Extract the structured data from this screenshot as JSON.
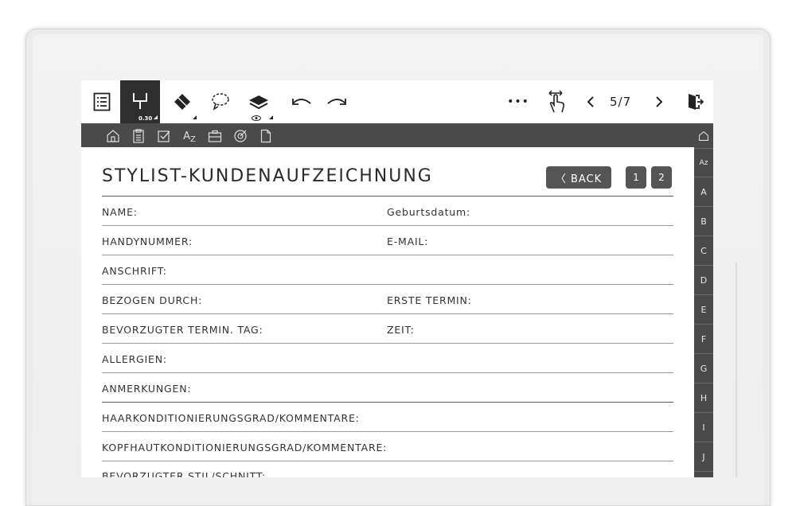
{
  "toolbar": {
    "pen_size": "0.30",
    "page_indicator": "5/7",
    "more": "•••"
  },
  "alphabet": [
    "A",
    "B",
    "C",
    "D",
    "E",
    "F",
    "G",
    "H",
    "I",
    "J"
  ],
  "alphabet_az": "Az",
  "form": {
    "title": "STYLIST-KUNDENAUFZEICHNUNG",
    "back": "〈 BACK",
    "pages": [
      "1",
      "2"
    ],
    "rows": [
      {
        "left": "NAME:",
        "right": "Geburtsdatum:"
      },
      {
        "left": "HANDYNUMMER:",
        "right": "E-MAIL:"
      },
      {
        "left": "ANSCHRIFT:",
        "right": ""
      },
      {
        "left": "BEZOGEN DURCH:",
        "right": "ERSTE TERMIN:"
      },
      {
        "left": "BEVORZUGTER TERMIN. TAG:",
        "right": "ZEIT:"
      },
      {
        "left": "ALLERGIEN:",
        "right": ""
      },
      {
        "left": "ANMERKUNGEN:",
        "right": ""
      },
      {
        "left": "HAARKONDITIONIERUNGSGRAD/KOMMENTARE:",
        "right": ""
      },
      {
        "left": "KOPFHAUTKONDITIONIERUNGSGRAD/KOMMENTARE:",
        "right": ""
      },
      {
        "left": "BEVORZUGTER STIL/SCHNITT:",
        "right": ""
      }
    ]
  },
  "colors": {
    "bar": "#4a4a4a",
    "button": "#555555",
    "active_tool": "#2e2e2e"
  }
}
